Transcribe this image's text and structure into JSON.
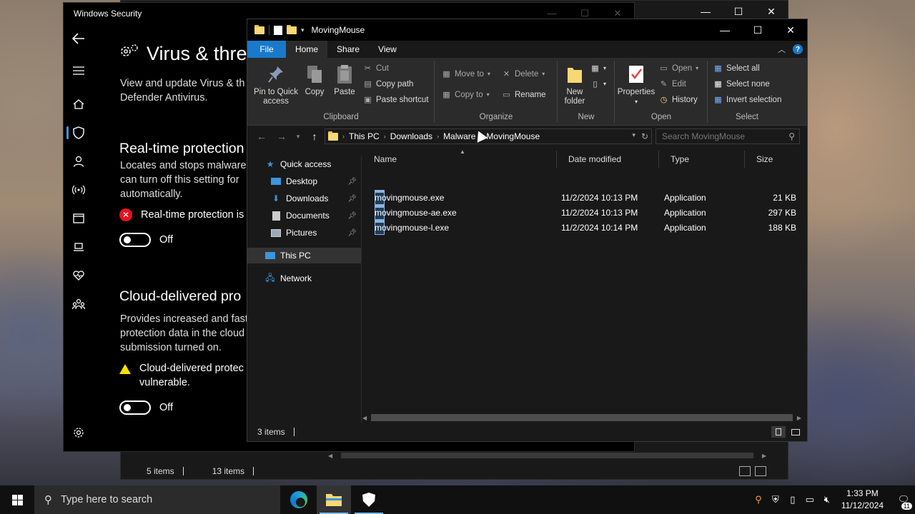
{
  "back_explorer": {
    "status_left": "5 items",
    "status_right": "13 items"
  },
  "winsec": {
    "window_title": "Windows Security",
    "page_title": "Virus & thre",
    "intro_line1": "View and update Virus & th",
    "intro_line2": "Defender Antivirus.",
    "rtp_heading": "Real-time protection",
    "rtp_desc1": "Locates and stops malware",
    "rtp_desc2": "can turn off this setting for",
    "rtp_desc3": "automatically.",
    "rtp_status": "Real-time protection is",
    "rtp_toggle": "Off",
    "cdp_heading": "Cloud-delivered pro",
    "cdp_desc1": "Provides increased and fast",
    "cdp_desc2": "protection data in the cloud",
    "cdp_desc3": "submission turned on.",
    "cdp_status1": "Cloud-delivered protec",
    "cdp_status2": "vulnerable.",
    "cdp_toggle": "Off"
  },
  "explorer": {
    "window_title": "MovingMouse",
    "tabs": [
      "File",
      "Home",
      "Share",
      "View"
    ],
    "ribbon": {
      "clipboard": {
        "label": "Clipboard",
        "pin": "Pin to Quick access",
        "copy": "Copy",
        "paste": "Paste",
        "cut": "Cut",
        "copy_path": "Copy path",
        "paste_shortcut": "Paste shortcut"
      },
      "organize": {
        "label": "Organize",
        "move_to": "Move to",
        "copy_to": "Copy to",
        "delete": "Delete",
        "rename": "Rename"
      },
      "new": {
        "label": "New",
        "new_folder_line1": "New",
        "new_folder_line2": "folder"
      },
      "open": {
        "label": "Open",
        "properties": "Properties",
        "open": "Open",
        "edit": "Edit",
        "history": "History"
      },
      "select": {
        "label": "Select",
        "select_all": "Select all",
        "select_none": "Select none",
        "invert": "Invert selection"
      }
    },
    "breadcrumb": [
      "This PC",
      "Downloads",
      "Malware",
      "MovingMouse"
    ],
    "search_placeholder": "Search MovingMouse",
    "nav": {
      "quick_access": "Quick access",
      "desktop": "Desktop",
      "downloads": "Downloads",
      "documents": "Documents",
      "pictures": "Pictures",
      "this_pc": "This PC",
      "network": "Network"
    },
    "columns": [
      "Name",
      "Date modified",
      "Type",
      "Size"
    ],
    "files": [
      {
        "name": "movingmouse.exe",
        "date": "11/2/2024 10:13 PM",
        "type": "Application",
        "size": "21 KB"
      },
      {
        "name": "movingmouse-ae.exe",
        "date": "11/2/2024 10:13 PM",
        "type": "Application",
        "size": "297 KB"
      },
      {
        "name": "movingmouse-l.exe",
        "date": "11/2/2024 10:14 PM",
        "type": "Application",
        "size": "188 KB"
      }
    ],
    "status": "3 items"
  },
  "taskbar": {
    "search_placeholder": "Type here to search",
    "time": "1:33 PM",
    "date": "11/12/2024",
    "notif_count": "11"
  },
  "colors": {
    "accent": "#1979ca",
    "error": "#e81123",
    "warning": "#fce100",
    "folder": "#f8d775"
  }
}
